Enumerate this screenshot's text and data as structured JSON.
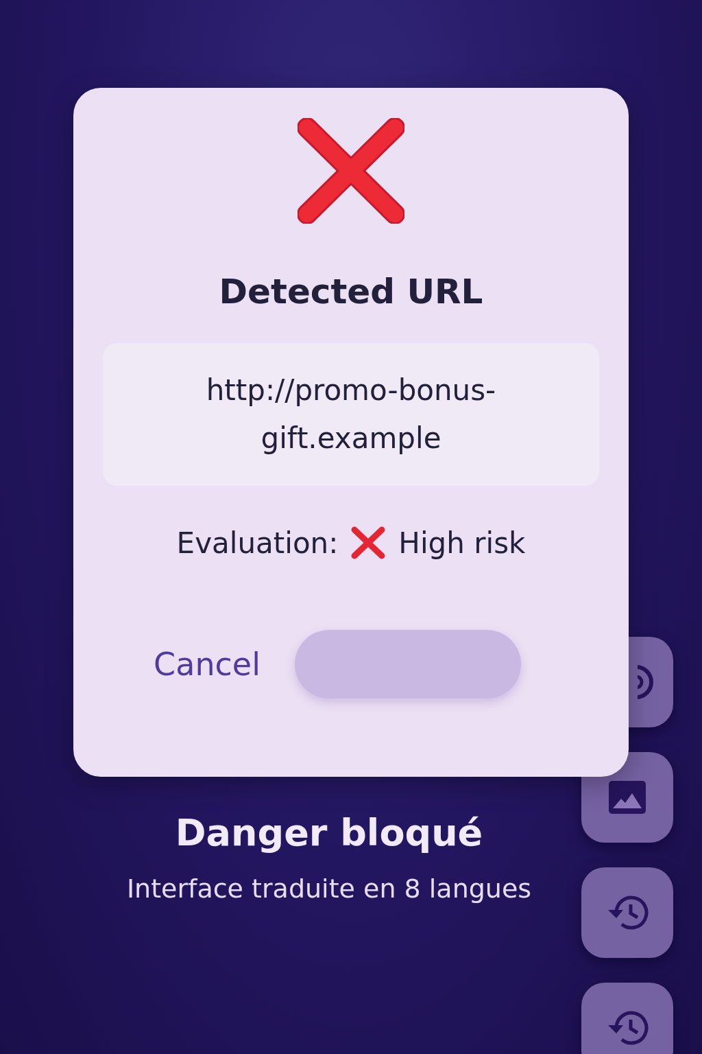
{
  "dialog": {
    "title": "Detected URL",
    "url": "http://promo-bonus-gift.example",
    "evaluation_label": "Evaluation:",
    "risk": "High risk",
    "cancel_button": "Cancel"
  },
  "caption": {
    "title": "Danger bloqué",
    "subtitle": "Interface traduite en 8 langues"
  }
}
